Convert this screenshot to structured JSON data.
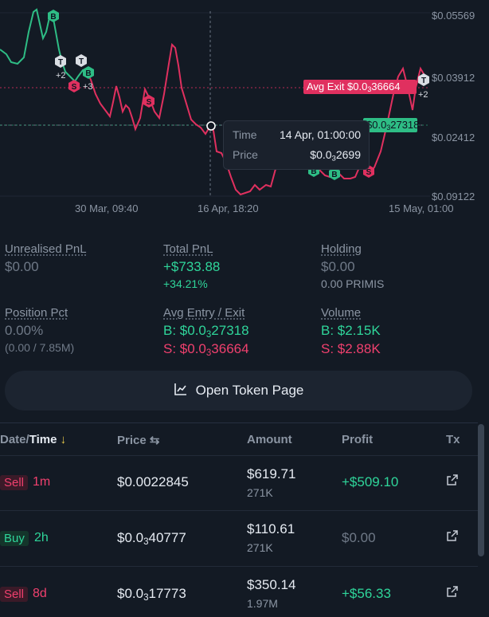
{
  "chart": {
    "y_labels": [
      {
        "pre": "$0.0",
        "sub": "",
        "post": "5569"
      },
      {
        "pre": "$0.0",
        "sub": "",
        "post": "3912"
      },
      {
        "pre": "$0.0",
        "sub": "",
        "post": "2412"
      },
      {
        "pre": "$0.0",
        "sub": "",
        "post": "9122"
      }
    ],
    "x_labels": [
      "30 Mar, 09:40",
      "16 Apr, 18:20",
      "15 May, 01:00"
    ],
    "avg_exit_tag": {
      "pre": "Avg Exit $0.0",
      "sub": "3",
      "post": "36664"
    },
    "avg_entry_tag": {
      "pre": "$0.0",
      "sub": "3",
      "post": "27318"
    },
    "tooltip": {
      "time_label": "Time",
      "time_value": "14 Apr, 01:00:00",
      "price_label": "Price",
      "price_value": {
        "pre": "$0.0",
        "sub": "3",
        "post": "2699"
      }
    },
    "markers": {
      "b": "B",
      "s": "S",
      "t": "T",
      "count_2": "+2",
      "count_3": "+3"
    },
    "colors": {
      "up": "#2ebd85",
      "down": "#e0305f",
      "grid": "#1f2733"
    }
  },
  "stats": {
    "unrealised": {
      "label": "Unrealised PnL",
      "value": "$0.00"
    },
    "total": {
      "label": "Total PnL",
      "value": "+$733.88",
      "pct": "+34.21%"
    },
    "holding": {
      "label": "Holding",
      "value": "$0.00",
      "sub": "0.00 PRIMIS"
    },
    "position": {
      "label": "Position Pct",
      "value": "0.00%",
      "sub": "(0.00 / 7.85M)"
    },
    "avg": {
      "label": "Avg Entry / Exit",
      "buy": {
        "pre": "B: $0.0",
        "sub": "3",
        "post": "27318"
      },
      "sell": {
        "pre": "S: $0.0",
        "sub": "3",
        "post": "36664"
      }
    },
    "volume": {
      "label": "Volume",
      "buy": "B: $2.15K",
      "sell": "S: $2.88K"
    }
  },
  "open_token_button": "Open Token Page",
  "table": {
    "headers": {
      "date": "Date/",
      "time": "Time",
      "sort_arrow": "↓",
      "price": "Price",
      "price_toggle": "⇆",
      "amount": "Amount",
      "profit": "Profit",
      "tx": "Tx"
    },
    "rows": [
      {
        "side": "Sell",
        "age": "1m",
        "price": {
          "pre": "$0.0022845",
          "sub": "",
          "post": ""
        },
        "amount": "$619.71",
        "tokens": "271K",
        "profit": "+$509.10"
      },
      {
        "side": "Buy",
        "age": "2h",
        "price": {
          "pre": "$0.0",
          "sub": "3",
          "post": "40777"
        },
        "amount": "$110.61",
        "tokens": "271K",
        "profit": "$0.00"
      },
      {
        "side": "Sell",
        "age": "8d",
        "price": {
          "pre": "$0.0",
          "sub": "3",
          "post": "17773"
        },
        "amount": "$350.14",
        "tokens": "1.97M",
        "profit": "+$56.33"
      }
    ]
  }
}
